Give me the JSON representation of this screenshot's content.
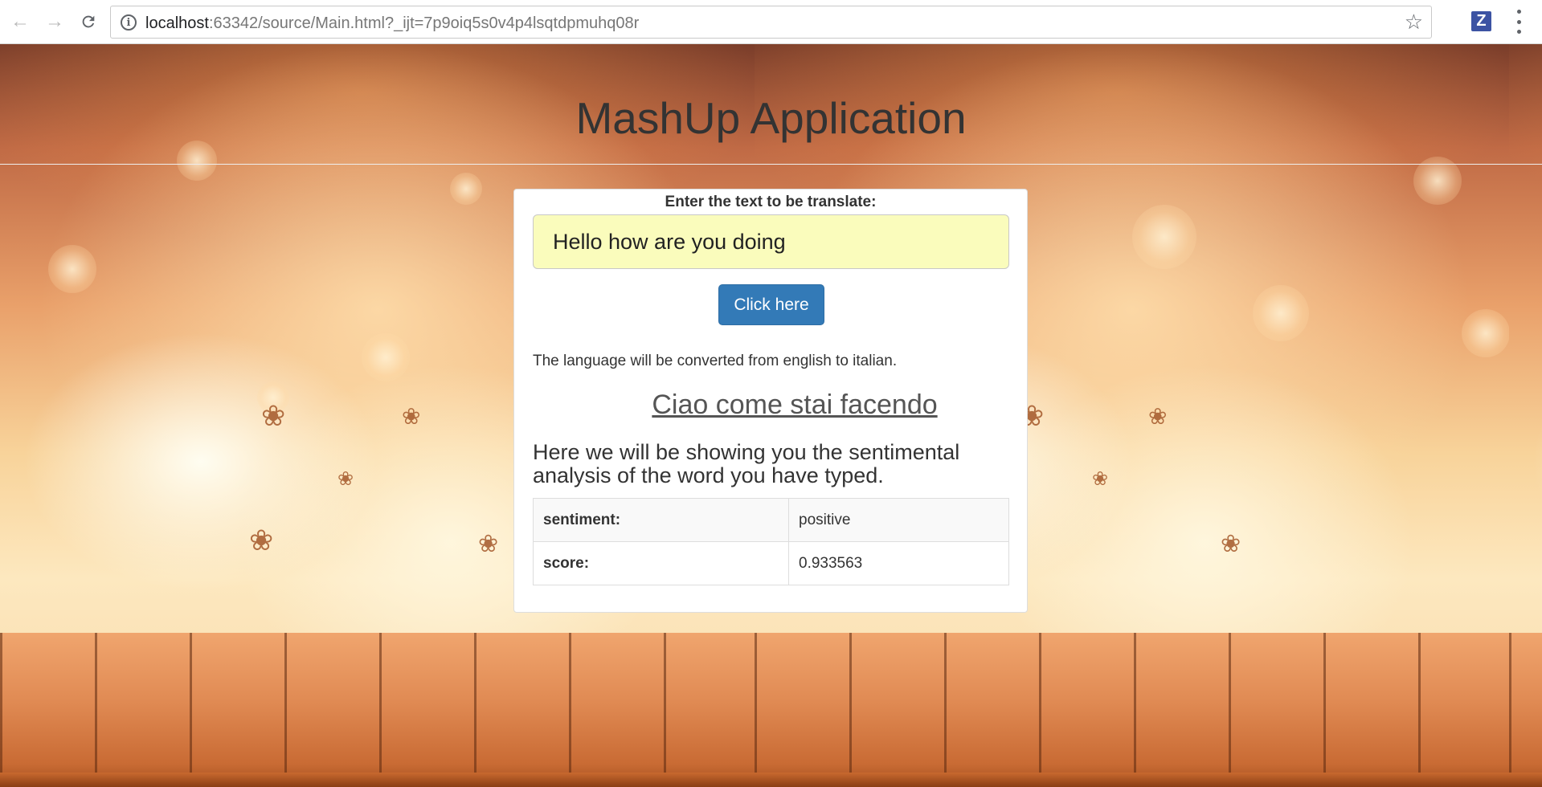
{
  "browser": {
    "url_host": "localhost",
    "url_rest": ":63342/source/Main.html?_ijt=7p9oiq5s0v4p4lsqtdpmuhq08r",
    "back_icon": "arrow-left-icon",
    "forward_icon": "arrow-right-icon",
    "reload_icon": "reload-icon",
    "info_icon": "info-icon",
    "star_icon": "star-icon",
    "extension_label": "Z",
    "menu_icon": "vertical-dots-icon"
  },
  "page": {
    "title": "MashUp Application"
  },
  "card": {
    "prompt": "Enter the text to be translate:",
    "input_value": "Hello how are you doing",
    "button_label": "Click here",
    "info": "The language will be converted from english to italian.",
    "translation": "Ciao come stai facendo",
    "description": "Here we will be showing you the sentimental analysis of the word you have typed.",
    "results": [
      {
        "key": "sentiment:",
        "value": "positive"
      },
      {
        "key": "score:",
        "value": "0.933563"
      }
    ]
  },
  "colors": {
    "button": "#337ab7",
    "input_background": "#fafcbc",
    "title": "#333333"
  }
}
